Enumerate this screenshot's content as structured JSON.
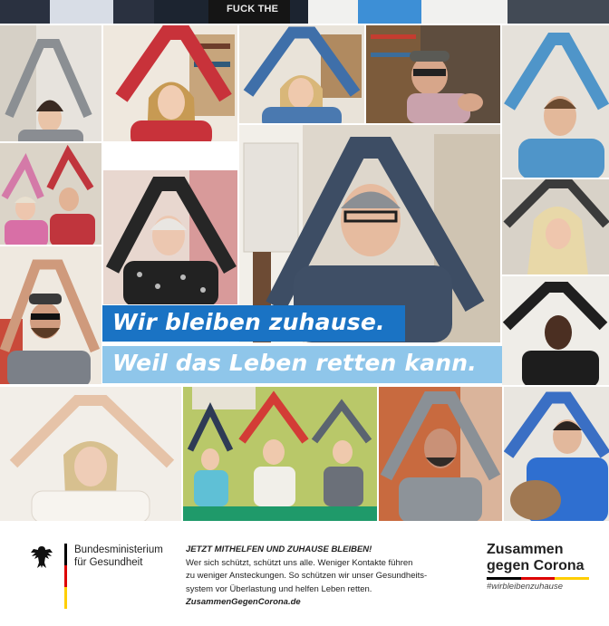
{
  "banner": {
    "line1": "Wir bleiben zuhause.",
    "line2": "Weil das Leben retten kann."
  },
  "footer": {
    "ministry_line1": "Bundesministerium",
    "ministry_line2": "für Gesundheit",
    "headline": "JETZT MITHELFEN UND ZUHAUSE BLEIBEN!",
    "body_line1": "Wer sich schützt, schützt uns alle. Weniger Kontakte führen",
    "body_line2": "zu weniger Ansteckungen. So schützen wir unser Gesundheits-",
    "body_line3": "system vor Überlastung und helfen Leben retten.",
    "url": "ZusammenGegenCorona.de",
    "campaign_line1": "Zusammen",
    "campaign_line2": "gegen Corona",
    "hashtag": "#wirbleibenzuhause",
    "shirt_text": "FUCK THE"
  },
  "colors": {
    "banner_dark": "#1a73c4",
    "banner_light": "#8fc6ea",
    "flag_black": "#000000",
    "flag_red": "#dd0000",
    "flag_gold": "#ffce00"
  },
  "icons": [
    "federal-eagle-icon"
  ]
}
